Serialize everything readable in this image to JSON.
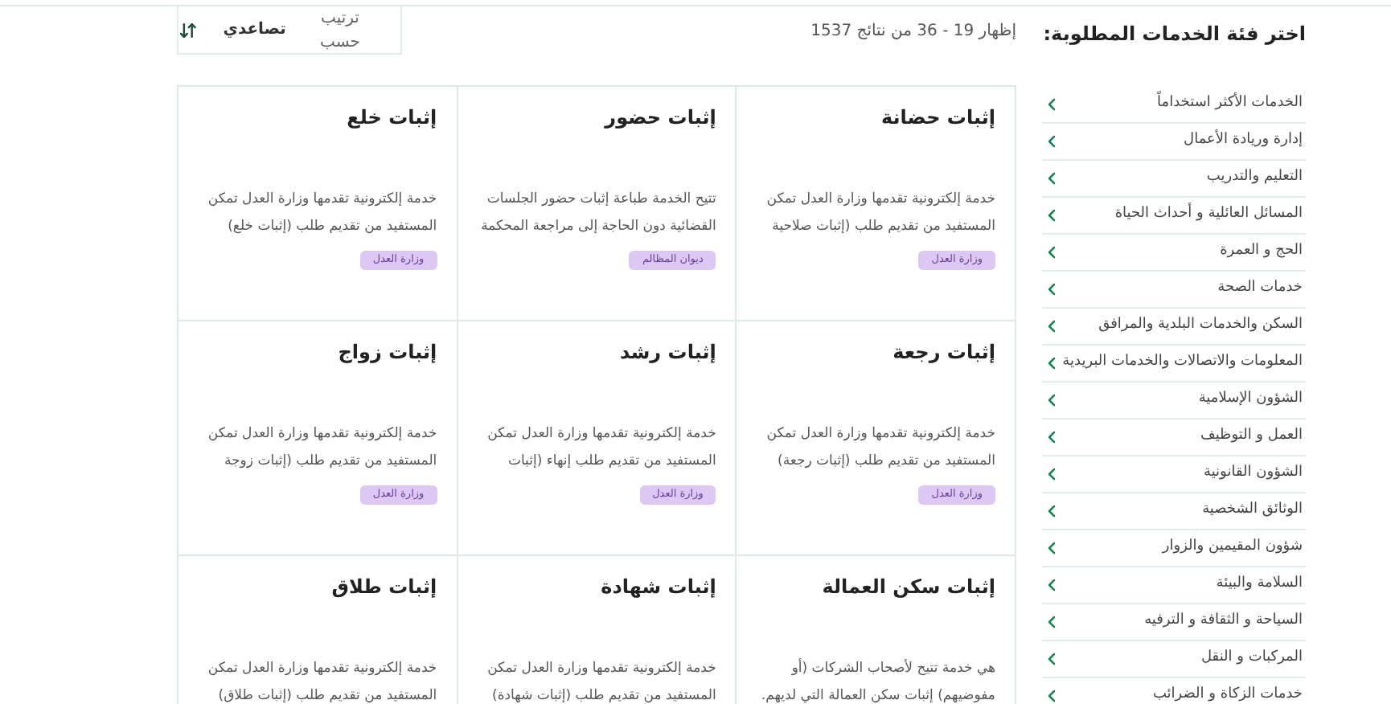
{
  "sidebar": {
    "heading": "اختر فئة الخدمات المطلوبة:",
    "items": [
      {
        "label": "الخدمات الأكثر استخداماً"
      },
      {
        "label": "إدارة وريادة الأعمال"
      },
      {
        "label": "التعليم والتدريب"
      },
      {
        "label": "المسائل العائلية و أحداث الحياة"
      },
      {
        "label": "الحج و العمرة"
      },
      {
        "label": "خدمات الصحة"
      },
      {
        "label": "السكن والخدمات البلدية والمرافق"
      },
      {
        "label": "المعلومات والاتصالات والخدمات البريدية"
      },
      {
        "label": "الشؤون الإسلامية"
      },
      {
        "label": "العمل و التوظيف"
      },
      {
        "label": "الشؤون القانونية"
      },
      {
        "label": "الوثائق الشخصية"
      },
      {
        "label": "شؤون المقيمين والزوار"
      },
      {
        "label": "السلامة والبيئة"
      },
      {
        "label": "السياحة و الثقافة و الترفيه"
      },
      {
        "label": "المركبات و النقل"
      },
      {
        "label": "خدمات الزكاة و الضرائب"
      }
    ]
  },
  "results": {
    "summary": "إظهار 19 - 36 من نتائج 1537",
    "sort": {
      "label": "ترتيب حسب",
      "value": "تصاعدي"
    }
  },
  "cards": [
    {
      "title": "إثبات حضانة",
      "description": [
        "خدمة إلكترونية تقدمها وزارة العدل تمكن",
        "المستفيد من تقديم طلب (إثبات صلاحية"
      ],
      "tag": "وزارة العدل"
    },
    {
      "title": "إثبات حضور",
      "description": [
        "تتيح الخدمة طباعة إثبات حضور الجلسات",
        "القضائية دون الحاجة إلى مراجعة المحكمة"
      ],
      "tag": "ديوان المظالم"
    },
    {
      "title": "إثبات خلع",
      "description": [
        "خدمة إلكترونية تقدمها وزارة العدل تمكن",
        "المستفيد من تقديم طلب (إثبات خلع)"
      ],
      "tag": "وزارة العدل"
    },
    {
      "title": "إثبات رجعة",
      "description": [
        "خدمة إلكترونية تقدمها وزارة العدل تمكن",
        "المستفيد من تقديم طلب (إثبات رجعة)"
      ],
      "tag": "وزارة العدل"
    },
    {
      "title": "إثبات رشد",
      "description": [
        "خدمة إلكترونية تقدمها وزارة العدل تمكن",
        "المستفيد من تقديم طلب إنهاء (إثبات"
      ],
      "tag": "وزارة العدل"
    },
    {
      "title": "إثبات زواج",
      "description": [
        "خدمة إلكترونية تقدمها وزارة العدل تمكن",
        "المستفيد من تقديم طلب (إثبات زوجة"
      ],
      "tag": "وزارة العدل"
    },
    {
      "title": "إثبات سكن العمالة",
      "description": [
        "هي خدمة تتيح لأصحاب الشركات (أو",
        "مفوضيهم) إثبات سكن العمالة التي لديهم."
      ]
    },
    {
      "title": "إثبات شهادة",
      "description": [
        "خدمة إلكترونية تقدمها وزارة العدل تمكن",
        "المستفيد من تقديم طلب (إثبات شهادة)"
      ]
    },
    {
      "title": "إثبات طلاق",
      "description": [
        "خدمة إلكترونية تقدمها وزارة العدل تمكن",
        "المستفيد من تقديم طلب (إثبات طلاق)"
      ]
    }
  ]
}
